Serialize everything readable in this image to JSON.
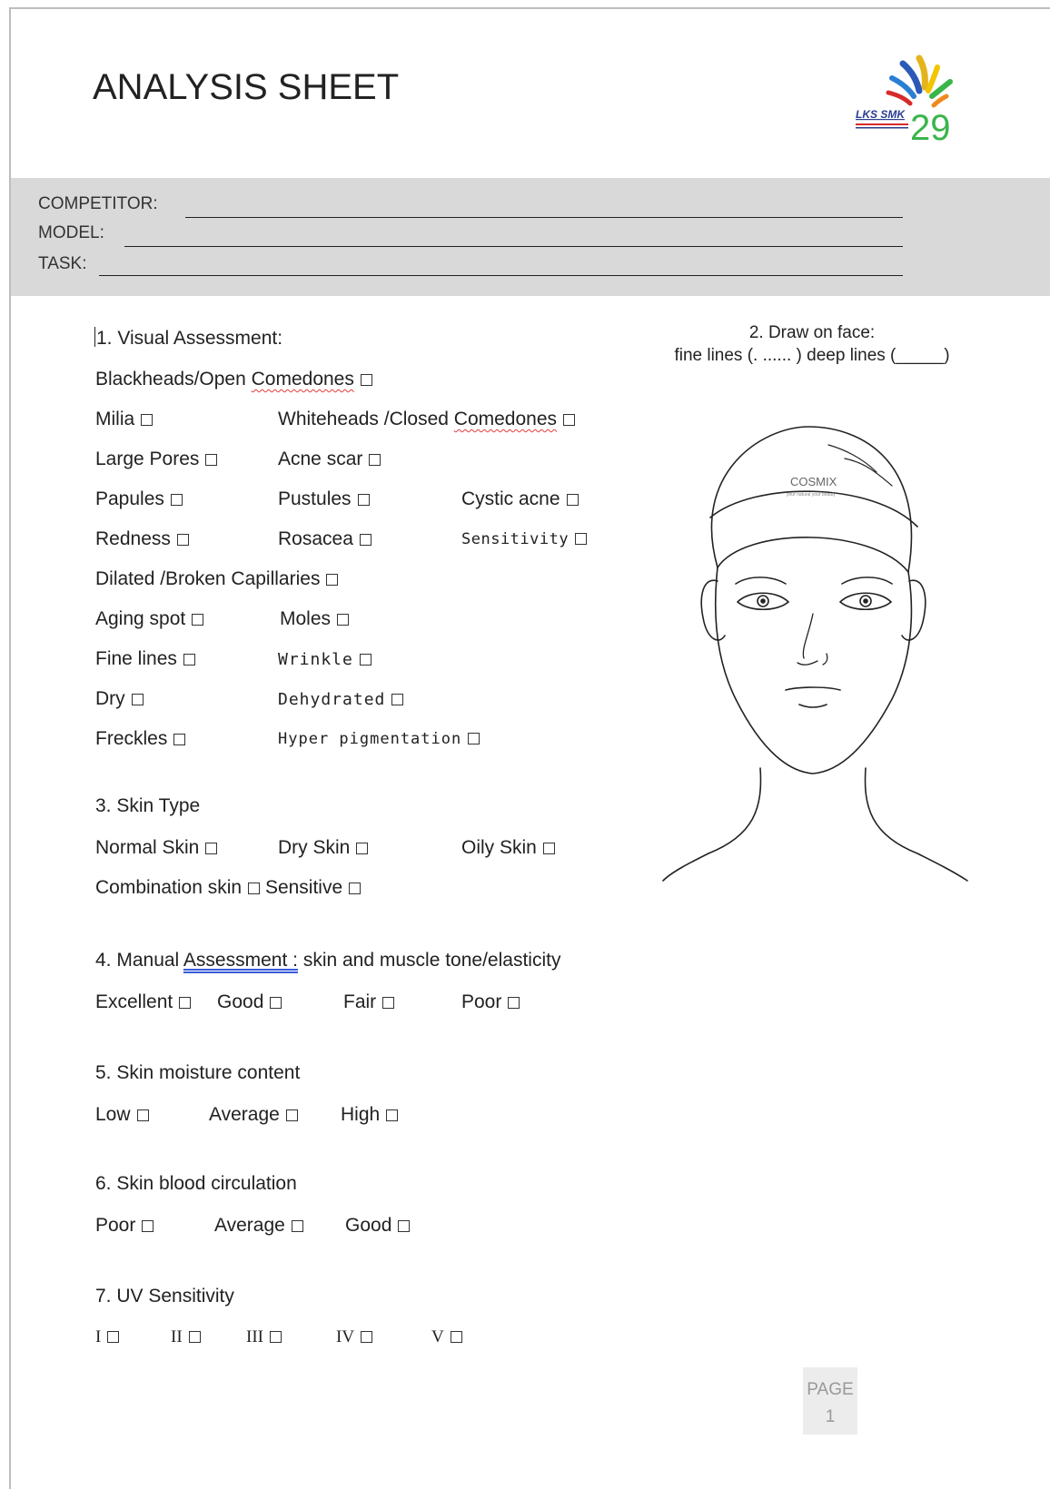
{
  "header": {
    "title": "ANALYSIS SHEET",
    "logo_text": "LKS SMK",
    "logo_number": "29"
  },
  "fields": {
    "competitor": "COMPETITOR:",
    "model": "MODEL:",
    "task": "TASK:"
  },
  "visual": {
    "heading": "1. Visual Assessment:",
    "blackheads": "Blackheads/Open",
    "comedones1": "Comedones",
    "milia": "Milia",
    "whiteheads": "Whiteheads /Closed",
    "comedones2": "Comedones",
    "large_pores": "Large Pores",
    "acne_scar": "Acne scar",
    "papules": "Papules",
    "pustules": "Pustules",
    "cystic_acne": "Cystic acne",
    "redness": "Redness",
    "rosacea": "Rosacea",
    "sensitivity": "Sensitivity",
    "dilated": "Dilated /Broken Capillaries",
    "aging_spot": "Aging spot",
    "moles": "Moles",
    "fine_lines": "Fine lines",
    "wrinkle": "Wrinkle",
    "dry": "Dry",
    "dehydrated": "Dehydrated",
    "freckles": "Freckles",
    "hyper_pigmentation": "Hyper pigmentation"
  },
  "face": {
    "caption_line1": "2. Draw on face:",
    "caption_line2": "fine lines (. ...... ) deep lines (_____)",
    "headband_text": "COSMIX",
    "headband_sub": "your natural your beauty"
  },
  "skin_type": {
    "heading": "3. Skin Type",
    "normal": "Normal Skin",
    "dry": "Dry Skin",
    "oily": "Oily Skin",
    "combination": "Combination skin",
    "sensitive": "Sensitive"
  },
  "manual": {
    "heading_prefix": "4. Manual",
    "heading_link": "Assessment :",
    "heading_suffix": "skin and muscle tone/elasticity",
    "excellent": "Excellent",
    "good": "Good",
    "fair": "Fair",
    "poor": "Poor"
  },
  "moisture": {
    "heading": "5. Skin moisture content",
    "low": "Low",
    "average": "Average",
    "high": "High"
  },
  "circulation": {
    "heading": "6. Skin blood circulation",
    "poor": "Poor",
    "average": "Average",
    "good": "Good"
  },
  "uv": {
    "heading": "7. UV Sensitivity",
    "i": "I",
    "ii": "II",
    "iii": "III",
    "iv": "IV",
    "v": "V"
  },
  "footer": {
    "page_label": "PAGE",
    "page_number": "1"
  }
}
